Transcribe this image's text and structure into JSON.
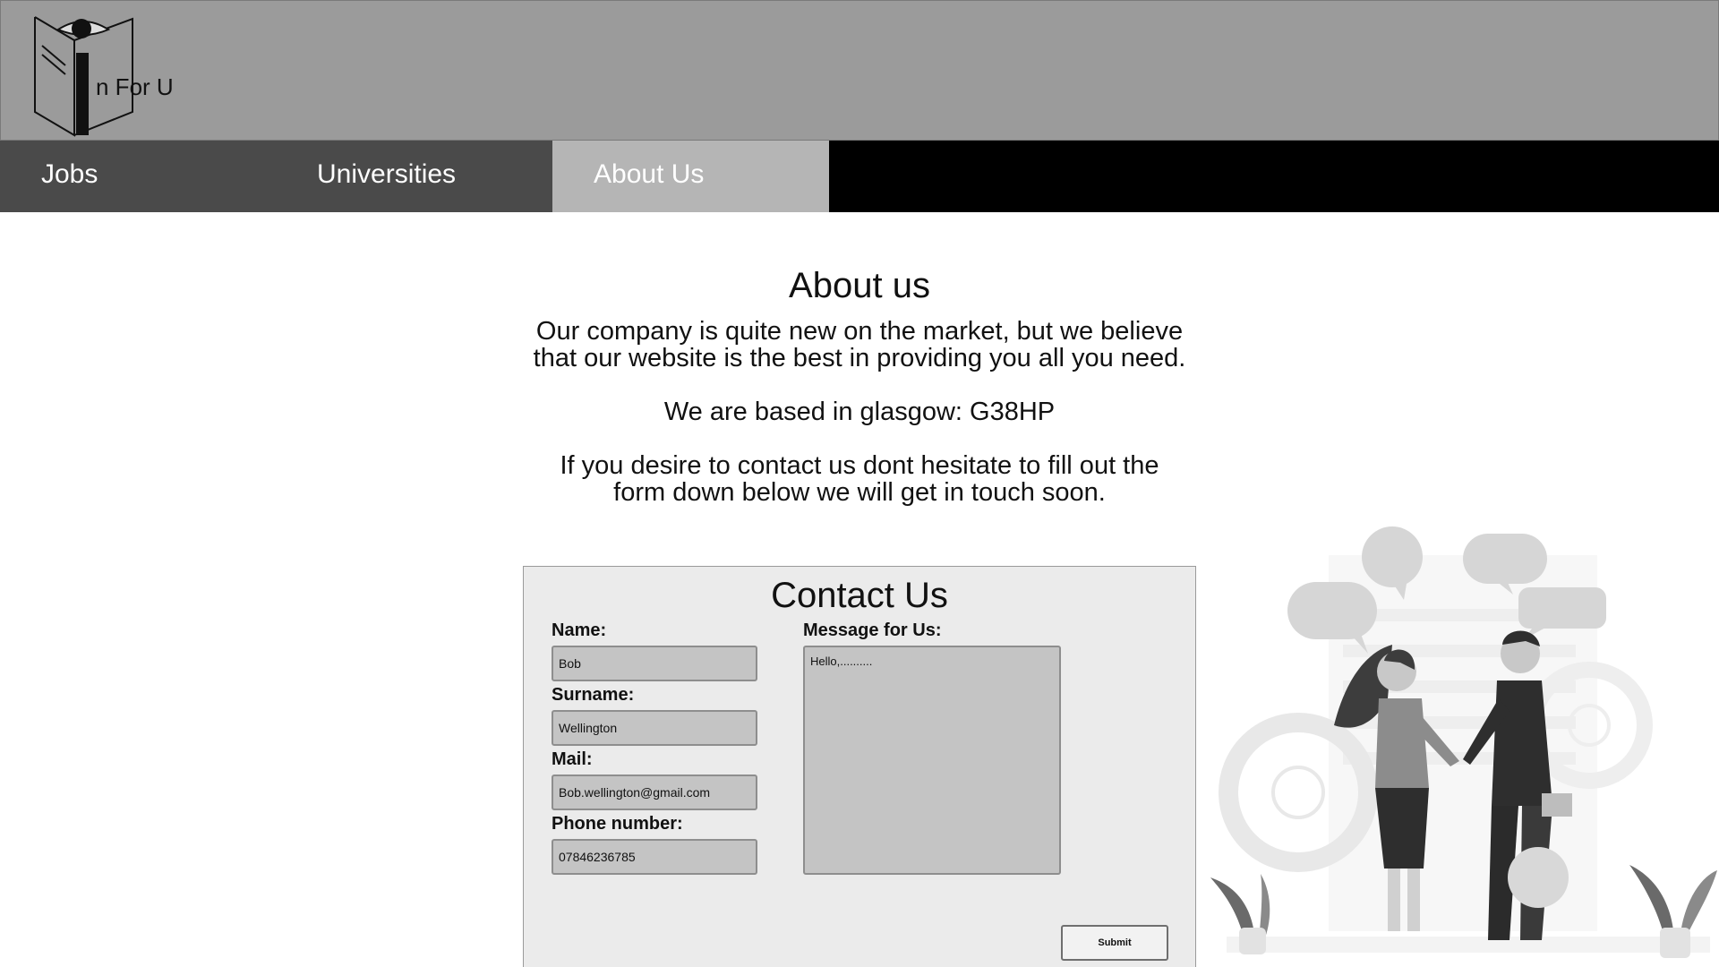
{
  "header": {
    "logo_text": "n For U"
  },
  "nav": {
    "items": [
      {
        "label": "Jobs"
      },
      {
        "label": "Universities"
      },
      {
        "label": "About Us"
      }
    ],
    "active": "About Us"
  },
  "intro": {
    "title": "About us",
    "paragraph1_line1": "Our company is quite new on the market, but we believe",
    "paragraph1_line2": "that our website is the best in providing you all you need.",
    "paragraph2": "We are based in glasgow: G38HP",
    "paragraph3_line1": "If you desire to contact us dont hesitate to fill out the",
    "paragraph3_line2": "form down below we will get in touch soon."
  },
  "contact": {
    "title": "Contact Us",
    "name_label": "Name:",
    "name_value": "Bob",
    "surname_label": "Surname:",
    "surname_value": "Wellington",
    "mail_label": "Mail:",
    "mail_value": "Bob.wellington@gmail.com",
    "phone_label": "Phone number:",
    "phone_value": "07846236785",
    "message_label": "Message for Us:",
    "message_value": "Hello,..........",
    "submit_label": "Submit"
  },
  "icons": {
    "logo": "book-eye-icon"
  },
  "colors": {
    "header_bg": "#9b9b9b",
    "nav_bg": "#4a4a4a",
    "nav_active_bg": "#b5b5b5",
    "form_bg": "#ebebeb",
    "input_bg": "#c4c4c4"
  }
}
